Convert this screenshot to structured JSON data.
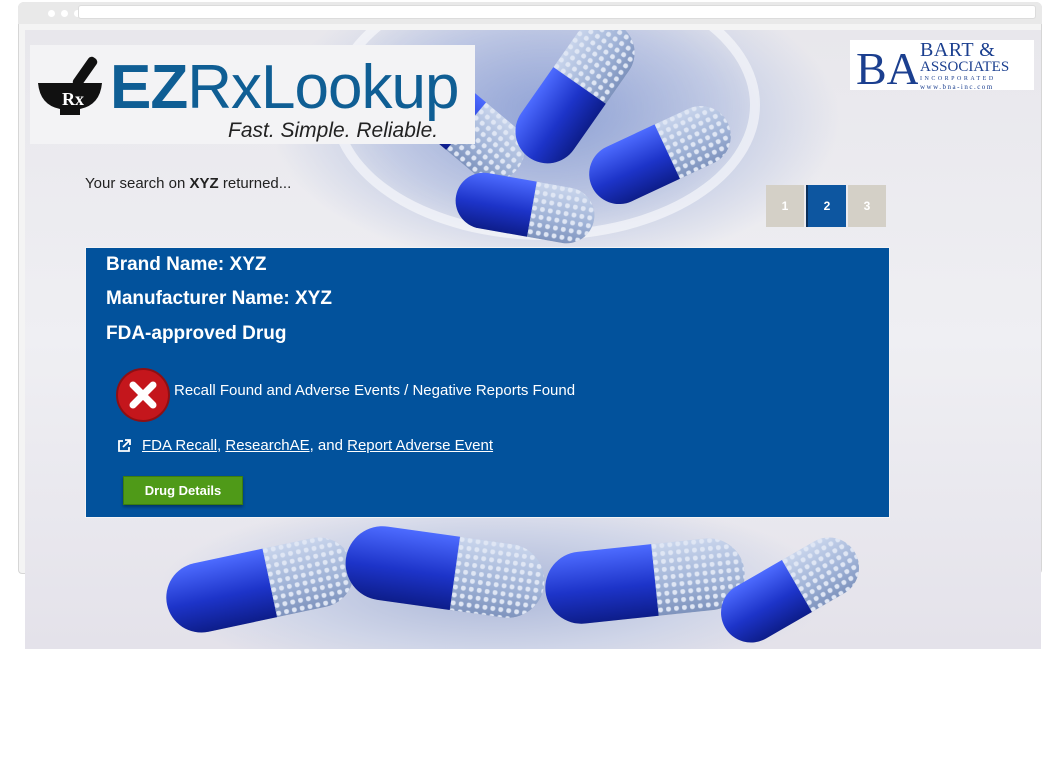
{
  "brand": {
    "logo_prefix": "EZ",
    "logo_mid": "Rx",
    "logo_suffix": "Lookup",
    "tagline": "Fast. Simple. Reliable.",
    "rx_mark": "Rx"
  },
  "partner_logo": {
    "line1": "BART &",
    "line2": "ASSOCIATES",
    "line3": "INCORPORATED",
    "line4": "www.bna-inc.com",
    "monogram": "BA"
  },
  "search": {
    "prefix": "Your search on ",
    "term": "XYZ",
    "suffix": " returned..."
  },
  "pagination": {
    "pages": [
      "1",
      "2",
      "3"
    ],
    "active": "2"
  },
  "result": {
    "brand_name": "Brand Name: XYZ",
    "manufacturer_name": "Manufacturer Name: XYZ",
    "approval": "FDA-approved Drug",
    "status_text": "Recall Found and Adverse Events / Negative Reports Found",
    "links": {
      "fda_recall": "FDA Recall",
      "sep1": ", ",
      "research_ae": "ResearchAE",
      "sep2": ", and ",
      "report_ae": "Report Adverse Event"
    },
    "details_button": "Drug Details"
  },
  "colors": {
    "card_bg": "#02529c",
    "button_green": "#4f9a18",
    "alert_red": "#c4161c",
    "logo_blue": "#0f5e94"
  },
  "icons": [
    "mortar-pestle-icon",
    "error-x-icon",
    "external-link-icon"
  ]
}
